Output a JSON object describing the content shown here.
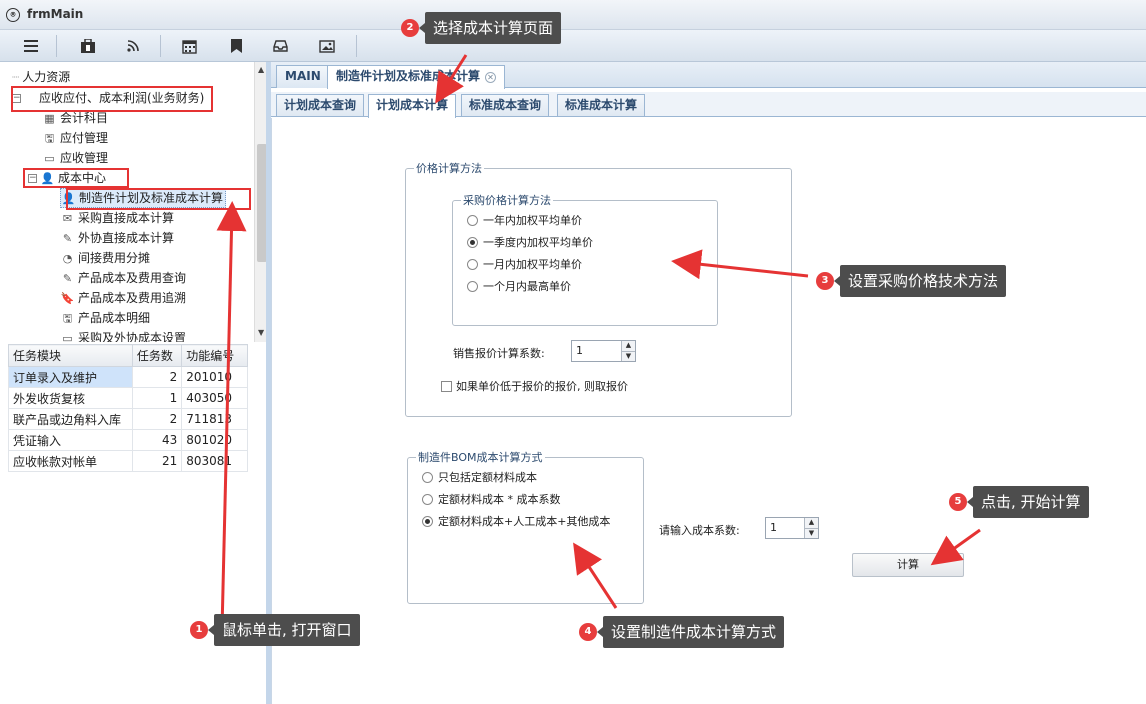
{
  "window": {
    "title": "frmMain"
  },
  "toolbar": {
    "icons": [
      "menu-icon",
      "briefcase-icon",
      "rss-icon",
      "calendar-icon",
      "bookmark-icon",
      "inbox-icon",
      "image-icon"
    ]
  },
  "tree": {
    "items": [
      {
        "label": "人力资源",
        "icon": ""
      },
      {
        "label": "应收应付、成本利润(业务财务)",
        "icon": "collapse"
      },
      {
        "label": "会计科目",
        "icon": "grid"
      },
      {
        "label": "应付管理",
        "icon": "save"
      },
      {
        "label": "应收管理",
        "icon": "monitor"
      },
      {
        "label": "成本中心",
        "icon": "user"
      },
      {
        "label": "制造件计划及标准成本计算",
        "icon": "user"
      },
      {
        "label": "采购直接成本计算",
        "icon": "mail"
      },
      {
        "label": "外协直接成本计算",
        "icon": "edit"
      },
      {
        "label": "间接费用分摊",
        "icon": "pie"
      },
      {
        "label": "产品成本及费用查询",
        "icon": "edit"
      },
      {
        "label": "产品成本及费用追溯",
        "icon": "bookmark"
      },
      {
        "label": "产品成本明细",
        "icon": "save"
      },
      {
        "label": "采购及外协成本设置",
        "icon": "monitor"
      }
    ]
  },
  "grid": {
    "headers": [
      "任务模块",
      "任务数",
      "功能编号"
    ],
    "rows": [
      [
        "订单录入及维护",
        "2",
        "201010"
      ],
      [
        "外发收货复核",
        "1",
        "403050"
      ],
      [
        "联产品或边角料入库",
        "2",
        "711813"
      ],
      [
        "凭证输入",
        "43",
        "801020"
      ],
      [
        "应收帐款对帐单",
        "21",
        "803081"
      ]
    ]
  },
  "main_tabs": [
    {
      "label": "MAIN"
    },
    {
      "label": "制造件计划及标准成本计算"
    }
  ],
  "sub_tabs": [
    {
      "label": "计划成本查询"
    },
    {
      "label": "计划成本计算"
    },
    {
      "label": "标准成本查询"
    },
    {
      "label": "标准成本计算"
    }
  ],
  "price_method": {
    "legend": "价格计算方法",
    "purchase_legend": "采购价格计算方法",
    "options": [
      "一年内加权平均单价",
      "一季度内加权平均单价",
      "一月内加权平均单价",
      "一个月内最高单价"
    ],
    "selected_index": 1,
    "coef_label": "销售报价计算系数:",
    "coef_value": "1",
    "checkbox_label": "如果单价低于报价的报价, 则取报价"
  },
  "bom_method": {
    "legend": "制造件BOM成本计算方式",
    "options": [
      "只包括定额材料成本",
      "定额材料成本 * 成本系数",
      "定额材料成本+人工成本+其他成本"
    ],
    "selected_index": 2
  },
  "cost_coef": {
    "label": "请输入成本系数:",
    "value": "1"
  },
  "calc_button": {
    "label": "计算"
  },
  "annotations": [
    {
      "num": "1",
      "text": "鼠标单击, 打开窗口"
    },
    {
      "num": "2",
      "text": "选择成本计算页面"
    },
    {
      "num": "3",
      "text": "设置采购价格技术方法"
    },
    {
      "num": "4",
      "text": "设置制造件成本计算方式"
    },
    {
      "num": "5",
      "text": "点击, 开始计算"
    }
  ],
  "colors": {
    "accent_red": "#e53333",
    "tab_text": "#2c4a6e",
    "annotation_bg": "#4d4d4d"
  }
}
